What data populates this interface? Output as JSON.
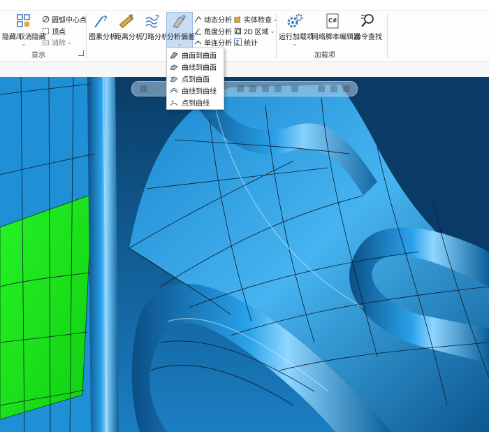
{
  "ribbon": {
    "display_group": {
      "label": "显示",
      "hide_button": "隐藏/取消隐藏",
      "arc_center_button": "圆弧中心点",
      "vertex_button": "顶点",
      "remove_button": "消除"
    },
    "analysis_group": {
      "element_analysis": "图素分析",
      "distance_analysis": "距离分析",
      "toolpath_analysis": "刀路分析",
      "deviation_analysis": "分析偏差",
      "dynamic_analysis": "动态分析",
      "angle_analysis": "角度分析",
      "single_analysis": "单连分析",
      "solid_check": "实体检查",
      "area_2d": "2D 区域",
      "statistics": "统计"
    },
    "addins_group": {
      "label": "加载项",
      "run_addin": "运行加载项",
      "net_script_editor": "网络脚本编辑器",
      "command_search": "命令查找"
    }
  },
  "deviation_menu": {
    "items": [
      "曲面到曲面",
      "曲线到曲面",
      "点到曲面",
      "曲线到曲线",
      "点到曲线"
    ]
  },
  "colors": {
    "surface_blue": "#1f8fd6",
    "highlight_green": "#1ee61e",
    "wire": "#0b1a2a",
    "active_button": "#c9dcf3"
  }
}
